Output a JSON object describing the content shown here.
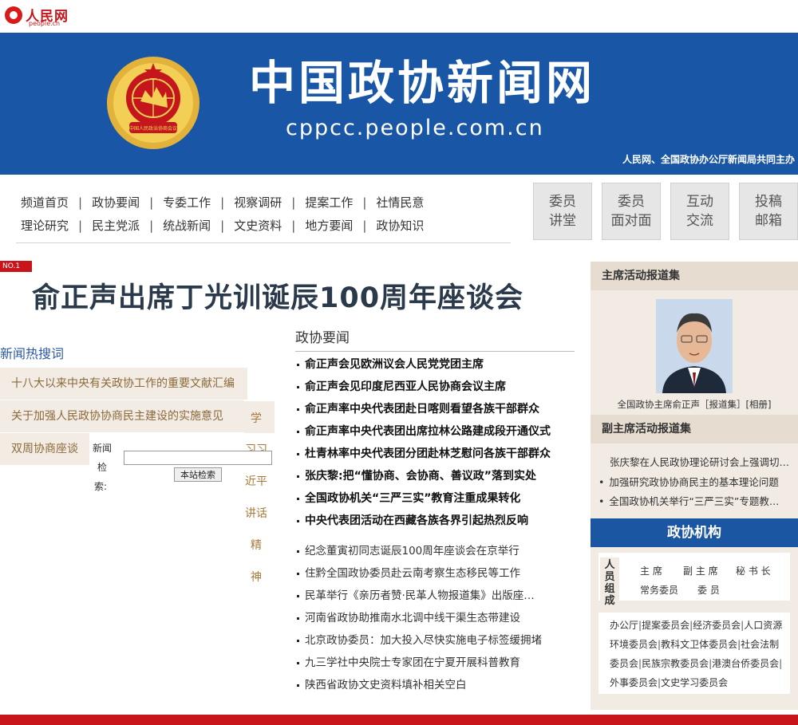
{
  "topbar": {
    "logo_cn": "人民网",
    "logo_en": "people.cn"
  },
  "banner": {
    "title": "中国政协新闻网",
    "domain": "cppcc.people.com.cn",
    "host_note": "人民网、全国政协办公厅新闻局共同主办",
    "emblem_text": "中国人民政治协商会议"
  },
  "nav": {
    "row1": [
      "频道首页",
      "政协要闻",
      "专委工作",
      "视察调研",
      "提案工作",
      "社情民意"
    ],
    "row2": [
      "理论研究",
      "民主党派",
      "统战新闻",
      "文史资料",
      "地方要闻",
      "政协知识"
    ],
    "buttons": [
      {
        "l1": "委员",
        "l2": "讲堂"
      },
      {
        "l1": "委员",
        "l2": "面对面"
      },
      {
        "l1": "互动",
        "l2": "交流"
      },
      {
        "l1": "投稿",
        "l2": "邮箱"
      }
    ]
  },
  "headline": {
    "badge": "NO.1",
    "text": "俞正声出席丁光训诞辰100周年座谈会"
  },
  "hot": {
    "title": "新闻热搜词",
    "items": [
      "十八大以来中央有关政协工作的重要文献汇编",
      "关于加强人民政协协商民主建设的实施意见",
      "双周协商座谈"
    ],
    "vertical_tab": [
      "学",
      "习习",
      "近平",
      "讲话",
      "精",
      "神"
    ]
  },
  "search": {
    "label_a": "新闻",
    "label_b": "检",
    "label_c": "索:",
    "input_value": "",
    "button": "本站检索"
  },
  "middle": {
    "title": "政协要闻",
    "top_news": [
      "俞正声会见欧洲议会人民党党团主席",
      "俞正声会见印度尼西亚人民协商会议主席",
      "俞正声率中央代表团赴日喀则看望各族干部群众",
      "俞正声率中央代表团出席拉林公路建成段开通仪式",
      "杜青林率中央代表团分团赴林芝慰问各族干部群众",
      "张庆黎:把“懂协商、会协商、善议政”落到实处",
      "全国政协机关“三严三实”教育注重成果转化",
      "中央代表团活动在西藏各族各界引起热烈反响"
    ],
    "more_news": [
      "纪念董寅初同志诞辰100周年座谈会在京举行",
      "住黔全国政协委员赴云南考察生态移民等工作",
      "民革举行《亲历者赞·民革人物报道集》出版座…",
      "河南省政协助推南水北调中线干渠生态带建设",
      "北京政协委员：加大投入尽快实施电子标签缓拥堵",
      "九三学社中央院士专家团在宁夏开展科普教育",
      "陕西省政协文史资料填补相关空白"
    ]
  },
  "right": {
    "chair_head": "主席活动报道集",
    "chair_caption": "全国政协主席俞正声［报道集］[相册]",
    "vice_head": "副主席活动报道集",
    "vice_items": [
      "张庆黎在人民政协理论研讨会上强调切…",
      "加强研究政协协商民主的基本理论问题",
      "全国政协机关举行“三严三实”专题教…"
    ],
    "org_head": "政协机构",
    "org_label": "人员组成",
    "org_people": [
      "主 席",
      "副 主 席",
      "秘 书 长",
      "常务委员",
      "委 员"
    ],
    "committees": [
      "办公厅",
      "提案委员会",
      "经济委员会",
      "人口资源环境委员会",
      "教科文卫体委员会",
      "社会法制委员会",
      "民族宗教委员会",
      "港澳台侨委员会",
      "外事委员会",
      "文史学习委员会"
    ],
    "committee_sep": "|"
  },
  "colors": {
    "banner_blue": "#1957a6",
    "brand_red": "#c8141b",
    "sidebar_beige": "#f1ebe3"
  }
}
